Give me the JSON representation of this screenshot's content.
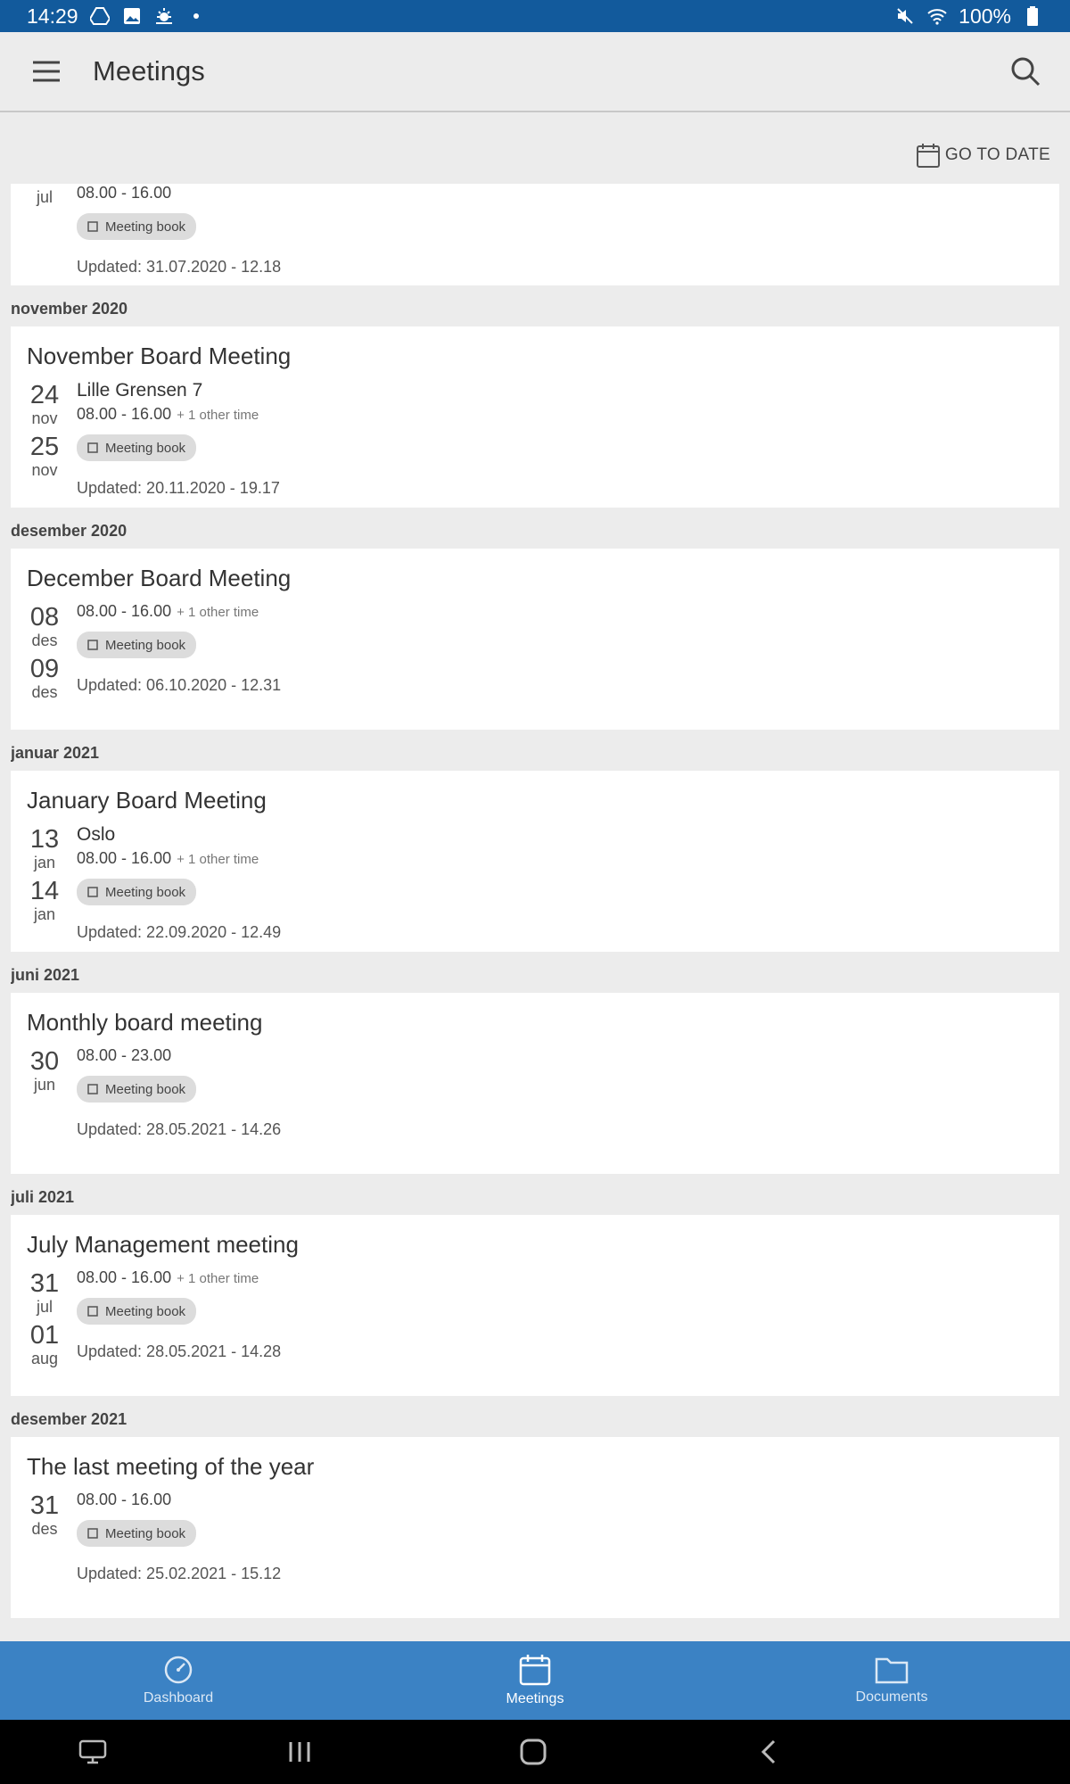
{
  "status_bar": {
    "time": "14:29",
    "battery": "100%"
  },
  "app_bar": {
    "title": "Meetings"
  },
  "toolbar": {
    "go_to_date": "GO TO DATE"
  },
  "partial_card": {
    "day_month": "jul",
    "time": "08.00 - 16.00",
    "chip": "Meeting book",
    "updated": "Updated: 31.07.2020 - 12.18"
  },
  "groups": [
    {
      "month": "november 2020",
      "title": "November Board Meeting",
      "location": "Lille Grensen 7",
      "day1": "24",
      "mon1": "nov",
      "day2": "25",
      "mon2": "nov",
      "time": "08.00 - 16.00",
      "other": "+ 1 other time",
      "chip": "Meeting book",
      "updated": "Updated: 20.11.2020 - 19.17"
    },
    {
      "month": "desember 2020",
      "title": "December Board Meeting",
      "day1": "08",
      "mon1": "des",
      "day2": "09",
      "mon2": "des",
      "time": "08.00 - 16.00",
      "other": "+ 1 other time",
      "chip": "Meeting book",
      "updated": "Updated: 06.10.2020 - 12.31"
    },
    {
      "month": "januar 2021",
      "title": "January Board Meeting",
      "location": "Oslo",
      "day1": "13",
      "mon1": "jan",
      "day2": "14",
      "mon2": "jan",
      "time": "08.00 - 16.00",
      "other": "+ 1 other time",
      "chip": "Meeting book",
      "updated": "Updated: 22.09.2020 - 12.49"
    },
    {
      "month": "juni 2021",
      "title": "Monthly board meeting",
      "day1": "30",
      "mon1": "jun",
      "time": "08.00 - 23.00",
      "chip": "Meeting book",
      "updated": "Updated: 28.05.2021 - 14.26"
    },
    {
      "month": "juli 2021",
      "title": "July Management meeting",
      "day1": "31",
      "mon1": "jul",
      "day2": "01",
      "mon2": "aug",
      "time": "08.00 - 16.00",
      "other": "+ 1 other time",
      "chip": "Meeting book",
      "updated": "Updated: 28.05.2021 - 14.28"
    },
    {
      "month": "desember 2021",
      "title": "The last meeting of the year",
      "day1": "31",
      "mon1": "des",
      "time": "08.00 - 16.00",
      "chip": "Meeting book",
      "updated": "Updated: 25.02.2021 - 15.12"
    }
  ],
  "bottom_nav": {
    "dashboard": "Dashboard",
    "meetings": "Meetings",
    "documents": "Documents"
  }
}
